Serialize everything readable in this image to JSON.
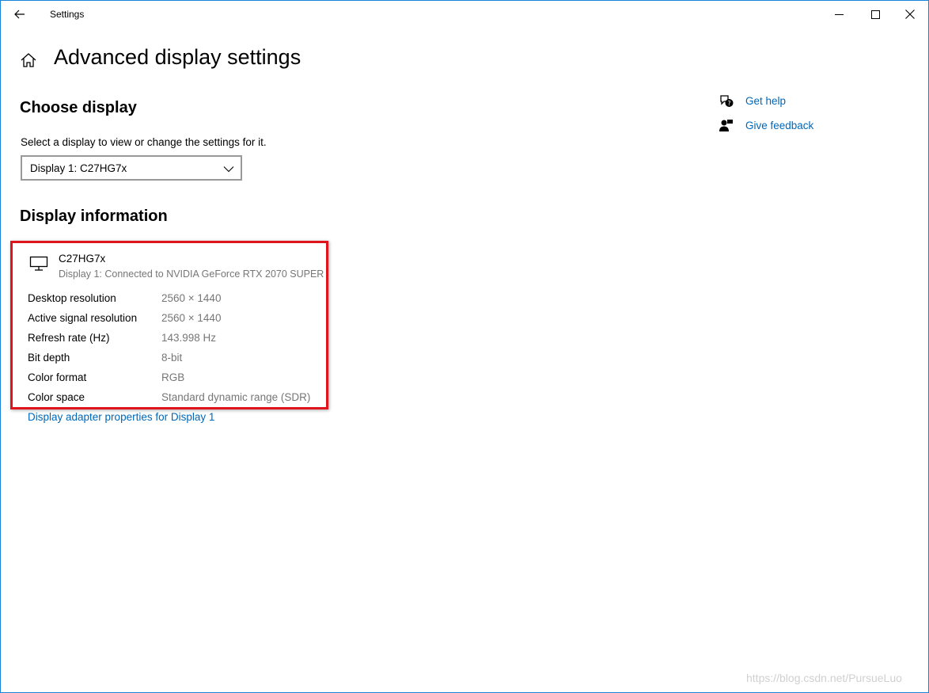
{
  "window": {
    "title": "Settings"
  },
  "header": {
    "title": "Advanced display settings"
  },
  "choose_display": {
    "title": "Choose display",
    "label": "Select a display to view or change the settings for it.",
    "selected": "Display 1: C27HG7x"
  },
  "display_info": {
    "title": "Display information",
    "monitor_name": "C27HG7x",
    "monitor_sub": "Display 1: Connected to NVIDIA GeForce RTX 2070 SUPER",
    "rows": [
      {
        "label": "Desktop resolution",
        "value": "2560 × 1440"
      },
      {
        "label": "Active signal resolution",
        "value": "2560 × 1440"
      },
      {
        "label": "Refresh rate (Hz)",
        "value": "143.998 Hz"
      },
      {
        "label": "Bit depth",
        "value": "8-bit"
      },
      {
        "label": "Color format",
        "value": "RGB"
      },
      {
        "label": "Color space",
        "value": "Standard dynamic range (SDR)"
      }
    ],
    "adapter_link": "Display adapter properties for Display 1"
  },
  "side_links": {
    "help": "Get help",
    "feedback": "Give feedback"
  },
  "watermark": "https://blog.csdn.net/PursueLuo",
  "icons": {
    "back": "back-arrow-icon",
    "minimize": "minimize-icon",
    "maximize": "maximize-icon",
    "close": "close-icon",
    "home": "home-icon",
    "chevron": "chevron-down-icon",
    "monitor": "monitor-icon",
    "help": "help-chat-icon",
    "feedback": "feedback-person-icon"
  },
  "colors": {
    "accent_link": "#0067b8",
    "window_border": "#1883d7",
    "highlight_border": "#e0141c",
    "secondary_text": "#767676"
  }
}
